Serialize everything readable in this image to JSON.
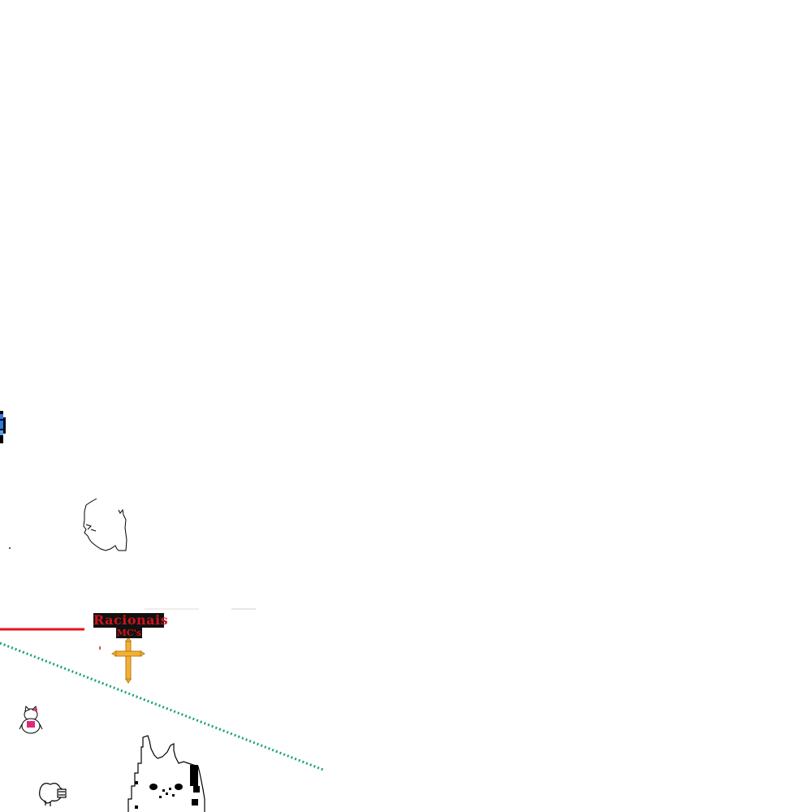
{
  "canvas": {
    "background": "#ffffff"
  },
  "logo": {
    "title": "Racionais",
    "subtitle": "MC's",
    "text_color": "#d0141c",
    "plate_color": "#111111"
  },
  "drawings": {
    "blue_sprite_icon": "partial-blue-pixel-sprite",
    "face_outline_icon": "profile-face-outline",
    "cross_icon": "golden-cross",
    "kitty_icon": "pink-kitty-figure",
    "sheep_icon": "small-sheep",
    "cat_icon": "white-pixel-cat",
    "stroke_colors": {
      "red_line": "#e0141c",
      "green_dotted": "#1aa66a",
      "gray_line": "#cccccc",
      "gold": "#f2b134",
      "blue": "#2a7be4",
      "pink": "#e0287a"
    }
  }
}
